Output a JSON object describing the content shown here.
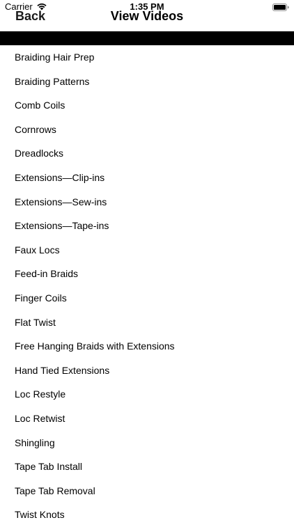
{
  "status_bar": {
    "carrier": "Carrier",
    "time": "1:35 PM",
    "icons": [
      "wifi-icon",
      "battery-icon"
    ]
  },
  "nav": {
    "back_label": "Back",
    "title": "View Videos"
  },
  "videos": [
    "Braiding Hair Prep",
    "Braiding Patterns",
    "Comb Coils",
    "Cornrows",
    "Dreadlocks",
    "Extensions—Clip-ins",
    "Extensions—Sew-ins",
    "Extensions—Tape-ins",
    "Faux Locs",
    "Feed-in Braids",
    "Finger Coils",
    "Flat Twist",
    "Free Hanging Braids with Extensions",
    "Hand Tied Extensions",
    "Loc Restyle",
    "Loc Retwist",
    "Shingling",
    "Tape Tab Install",
    "Tape Tab Removal",
    "Twist Knots"
  ]
}
